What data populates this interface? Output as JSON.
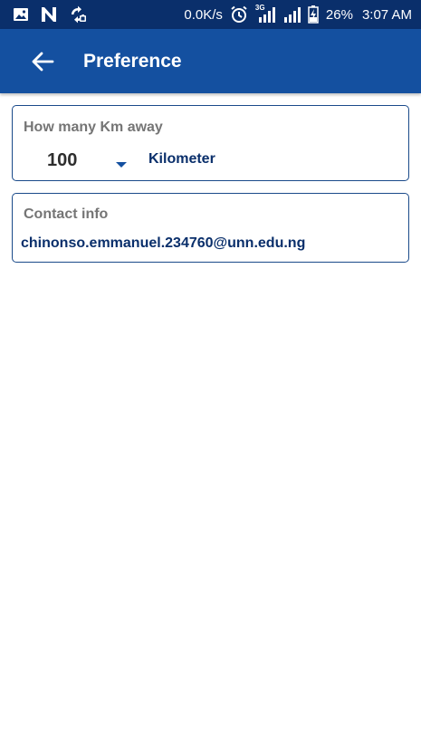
{
  "status_bar": {
    "icons_left": [
      "image-icon",
      "n-icon",
      "sync-icon"
    ],
    "net_speed": "0.0K/s",
    "network_type": "3G",
    "battery": "26%",
    "time": "3:07 AM"
  },
  "app_bar": {
    "title": "Preference",
    "back_icon": "arrow-back-icon"
  },
  "distance_card": {
    "label": "How many Km away",
    "selected_value": "100",
    "unit": "Kilometer"
  },
  "contact_card": {
    "label": "Contact info",
    "email": "chinonso.emmanuel.234760@unn.edu.ng"
  },
  "colors": {
    "status_bar": "#0a2f6b",
    "app_bar": "#1450a0",
    "accent_text": "#0a2f6b",
    "label_text": "#757575",
    "card_border": "#1a4a8a"
  }
}
